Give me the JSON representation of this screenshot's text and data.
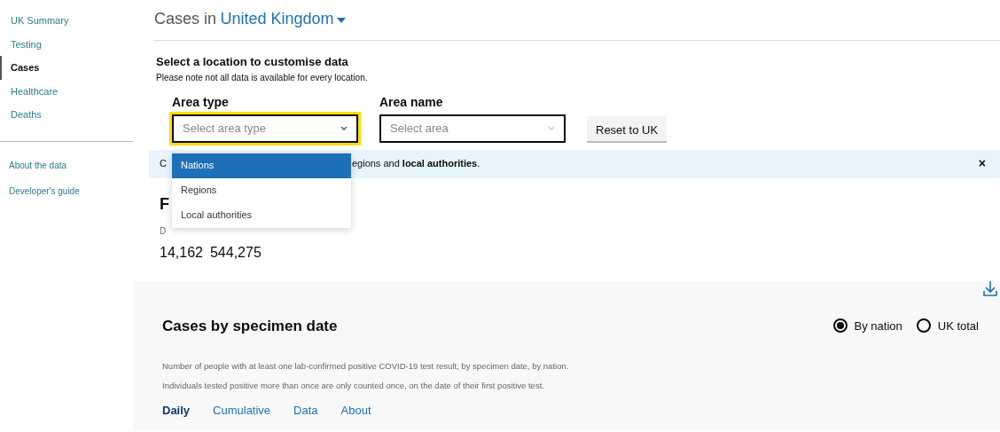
{
  "sidebar": {
    "items": [
      {
        "label": "UK Summary",
        "selected": false
      },
      {
        "label": "Testing",
        "selected": false
      },
      {
        "label": "Cases",
        "selected": true
      },
      {
        "label": "Healthcare",
        "selected": false
      },
      {
        "label": "Deaths",
        "selected": false
      }
    ],
    "links": [
      "About the data",
      "Developer's guide"
    ]
  },
  "header": {
    "title": "Cases in",
    "location": "United Kingdom"
  },
  "location_panel": {
    "title": "Select a location to customise data",
    "note": "Please note not all data is available for every location.",
    "area_type": {
      "label": "Area type",
      "placeholder": "Select area type",
      "expanded": true,
      "options": [
        {
          "label": "Nations",
          "selected": true
        },
        {
          "label": "Regions",
          "selected": false
        },
        {
          "label": "Local authorities",
          "selected": false
        }
      ]
    },
    "area_name": {
      "label": "Area name",
      "placeholder": "Select area"
    },
    "reset_button": "Reset to UK"
  },
  "banner": {
    "text_start": "C",
    "text_end": "egions and **local authorities**.",
    "close": "×"
  },
  "summary": {
    "heading": "F",
    "subheading": "D",
    "values": [
      "14,162",
      "544,275"
    ]
  },
  "card": {
    "title": "Cases by specimen date",
    "options": [
      {
        "label": "By nation",
        "selected": true
      },
      {
        "label": "UK total",
        "selected": false
      }
    ],
    "description": "Number of people with at least one lab-confirmed positive COVID-19 test result, by specimen date, by nation. Individuals tested positive more than once are only counted once, on the date of their first positive test.",
    "tabs": [
      {
        "label": "Daily",
        "selected": true
      },
      {
        "label": "Cumulative",
        "selected": false
      },
      {
        "label": "Data",
        "selected": false
      },
      {
        "label": "About",
        "selected": false
      }
    ]
  }
}
